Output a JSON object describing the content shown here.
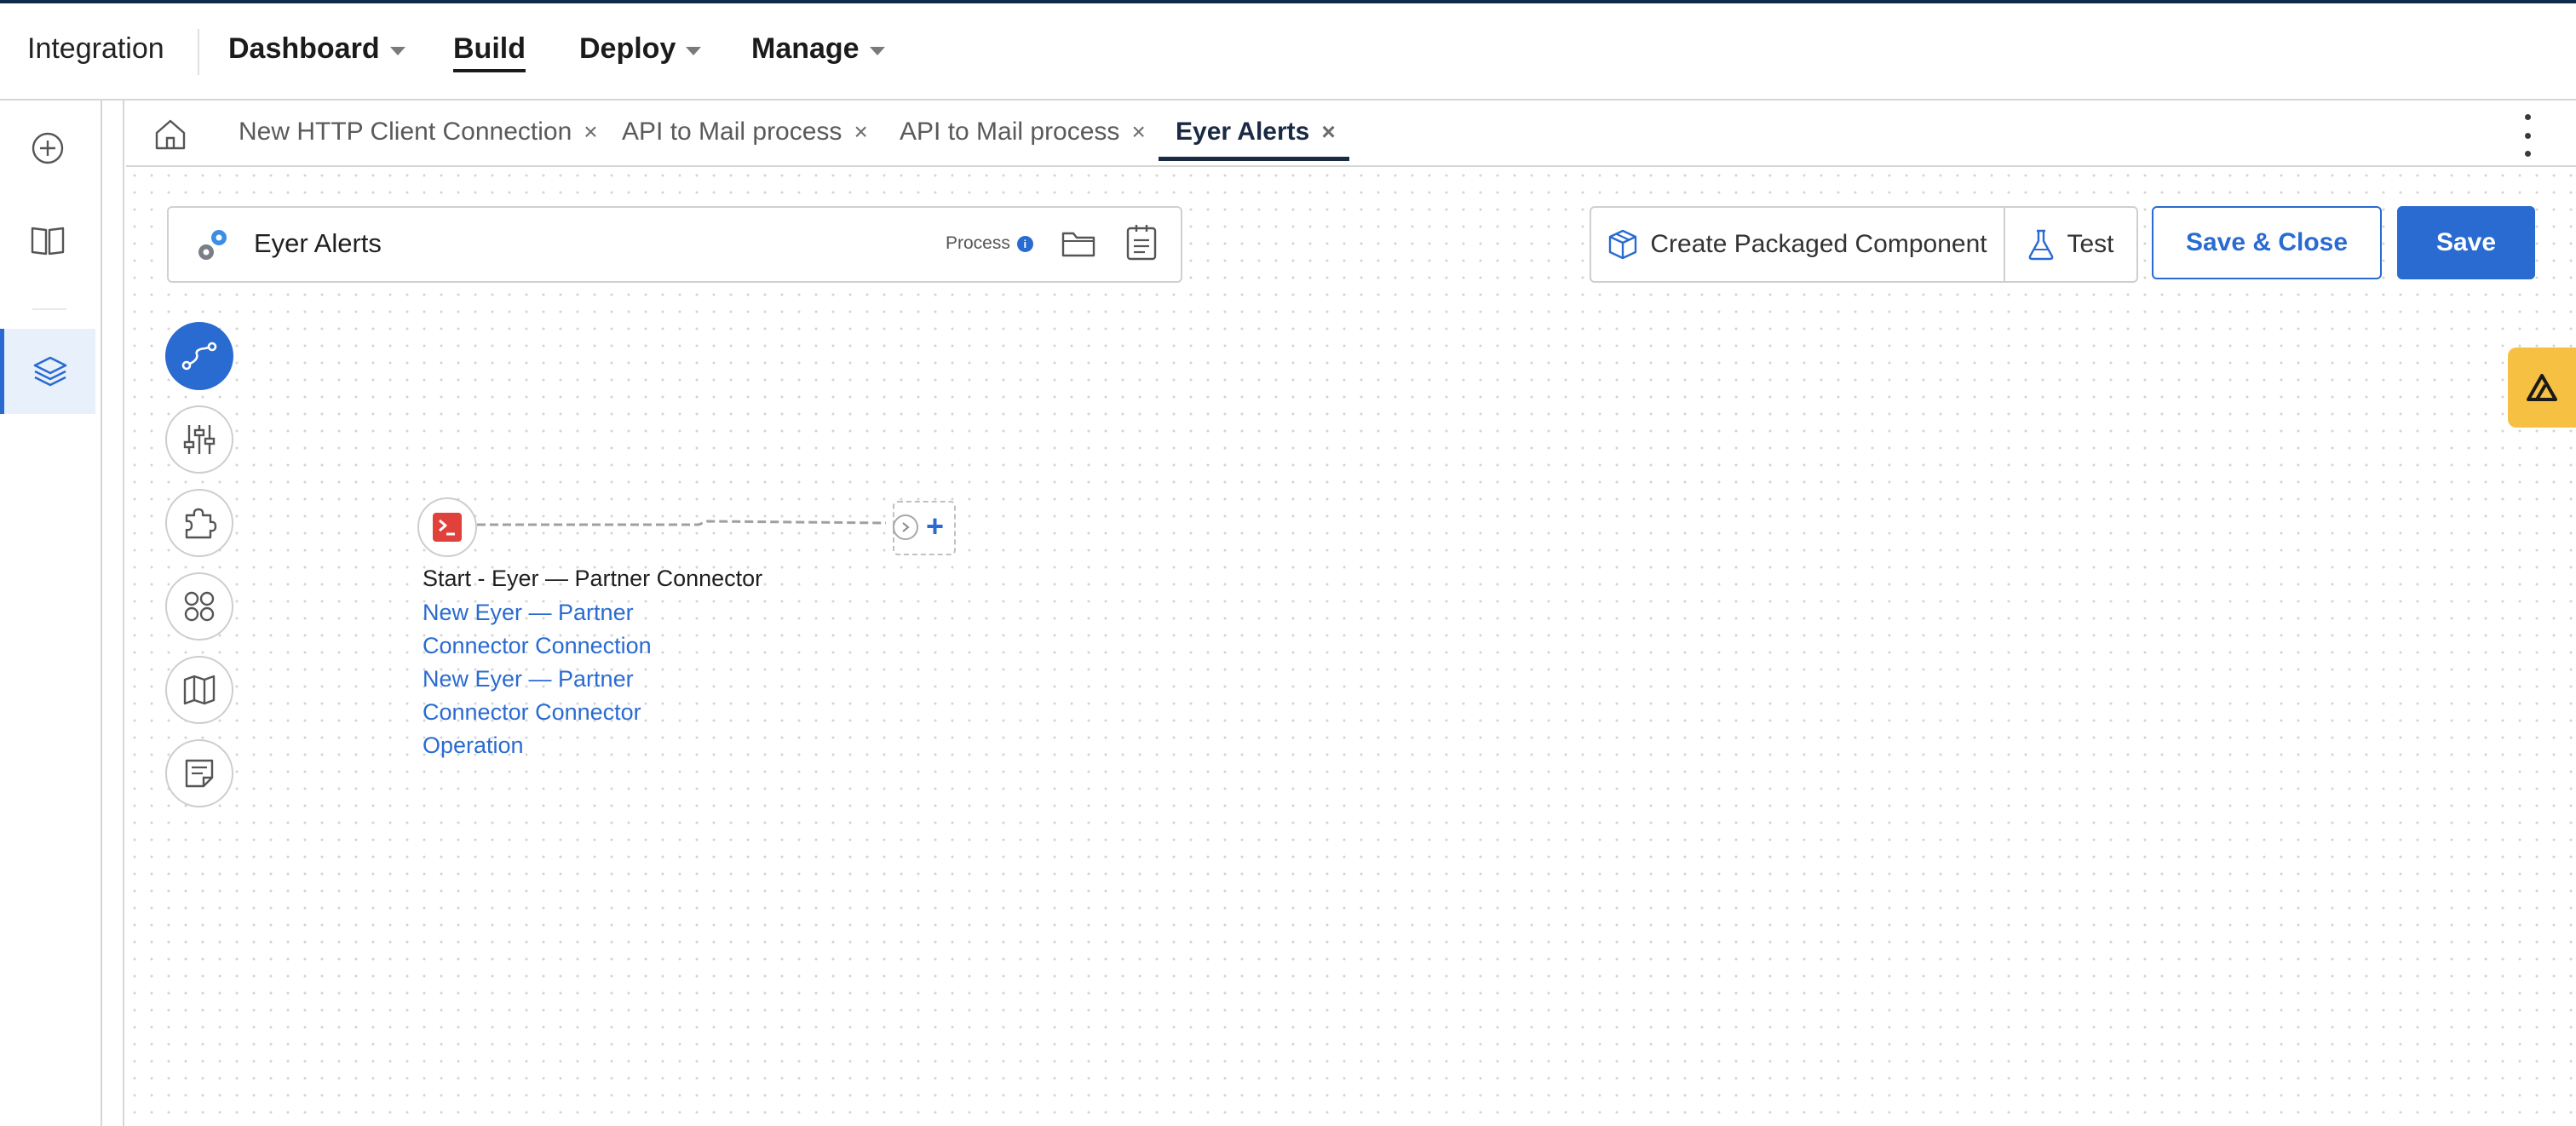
{
  "app": {
    "name": "Integration"
  },
  "nav": {
    "items": [
      {
        "label": "Dashboard",
        "has_caret": true
      },
      {
        "label": "Build",
        "has_caret": false,
        "active": true
      },
      {
        "label": "Deploy",
        "has_caret": true
      },
      {
        "label": "Manage",
        "has_caret": true
      }
    ]
  },
  "rail": {
    "items": [
      {
        "icon": "plus-circle-icon"
      },
      {
        "icon": "book-icon"
      },
      {
        "icon": "layers-icon",
        "active": true
      }
    ]
  },
  "tabs": {
    "home_icon": "home-icon",
    "items": [
      {
        "label": "New HTTP Client Connection",
        "close": "×"
      },
      {
        "label": "API to Mail process",
        "close": "×"
      },
      {
        "label": "API to Mail process",
        "close": "×"
      },
      {
        "label": "Eyer Alerts",
        "close": "×",
        "active": true
      }
    ]
  },
  "process": {
    "name": "Eyer Alerts",
    "type_label": "Process",
    "info_glyph": "i"
  },
  "toolbar": {
    "create_packaged_label": "Create Packaged Component",
    "test_label": "Test",
    "save_close_label": "Save & Close",
    "save_label": "Save"
  },
  "palette": {
    "items": [
      "route-icon",
      "sliders-icon",
      "puzzle-icon",
      "grid-circles-icon",
      "map-icon",
      "notes-icon"
    ]
  },
  "flow": {
    "start": {
      "title": "Start - Eyer — Partner Connector",
      "links": [
        "New Eyer — Partner",
        "Connector Connection",
        "New Eyer — Partner",
        "Connector Connector",
        "Operation"
      ]
    },
    "add_glyph": "+"
  },
  "colors": {
    "accent": "#2a6bd1",
    "nav_active": "#1a2a44",
    "start_node": "#e0413b",
    "assist_tab": "#f6c042"
  }
}
